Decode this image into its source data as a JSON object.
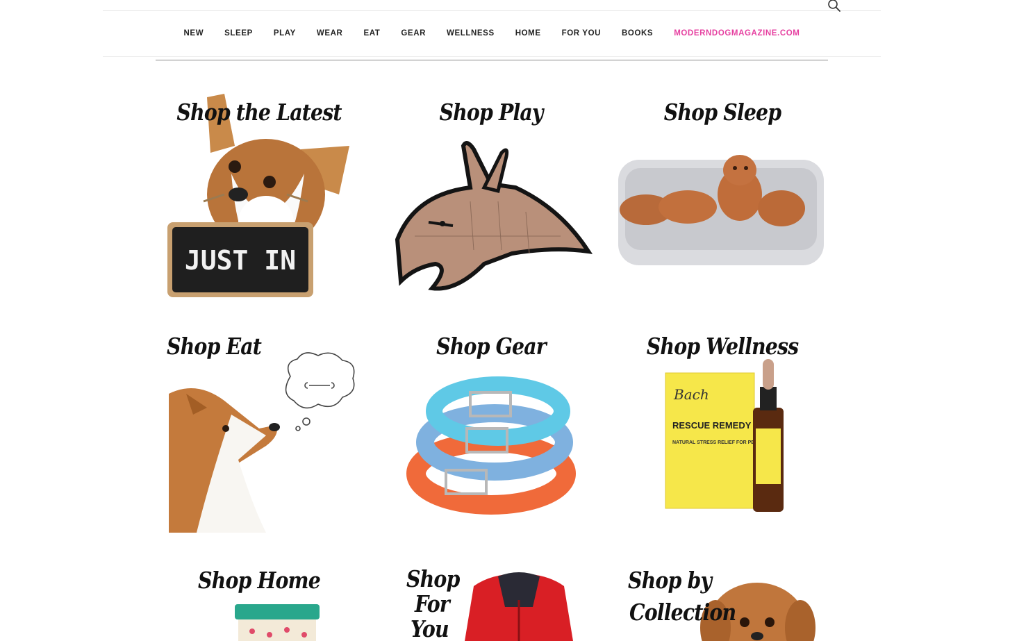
{
  "header": {
    "search_icon": "search-icon"
  },
  "nav": {
    "items": [
      {
        "label": "NEW"
      },
      {
        "label": "SLEEP"
      },
      {
        "label": "PLAY"
      },
      {
        "label": "WEAR"
      },
      {
        "label": "EAT"
      },
      {
        "label": "GEAR"
      },
      {
        "label": "WELLNESS"
      },
      {
        "label": "HOME"
      },
      {
        "label": "FOR YOU"
      },
      {
        "label": "BOOKS"
      },
      {
        "label": "MODERNDOGMAGAZINE.COM",
        "color": "#e63fa0"
      }
    ]
  },
  "tiles": [
    {
      "title": "Shop the Latest",
      "sign_text": "JUST IN"
    },
    {
      "title": "Shop Play"
    },
    {
      "title": "Shop Sleep"
    },
    {
      "title": "Shop Eat"
    },
    {
      "title": "Shop Gear"
    },
    {
      "title": "Shop Wellness",
      "product_brand": "Bach",
      "product_name": "RESCUE REMEDY",
      "product_sub": "NATURAL STRESS RELIEF FOR PETS"
    },
    {
      "title": "Shop Home"
    },
    {
      "title_lines": [
        "Shop",
        "For",
        "You"
      ]
    },
    {
      "title_lines": [
        "Shop by",
        "Collection"
      ]
    }
  ]
}
